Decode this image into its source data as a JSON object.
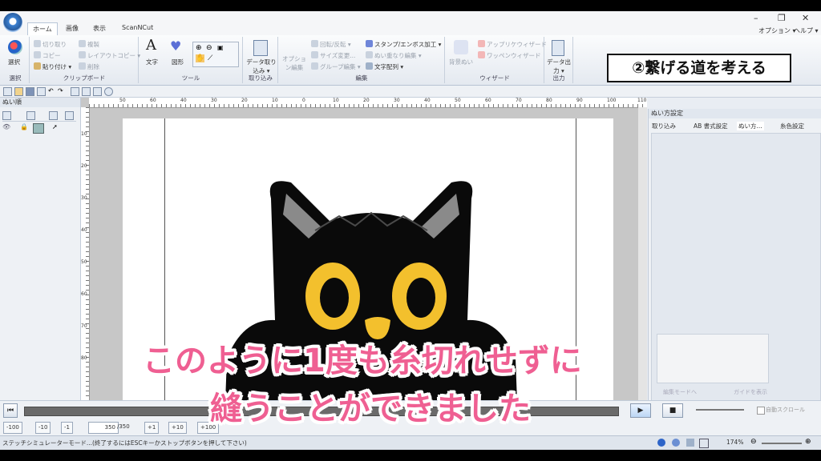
{
  "tabs": [
    "ホーム",
    "画像",
    "表示",
    "ScanNCut"
  ],
  "menu": {
    "options": "オプション ▾",
    "help": "ヘルプ ▾"
  },
  "ribbon": {
    "select": {
      "label": "選択",
      "group": "選択"
    },
    "clipboard": {
      "cut": "切り取り",
      "copy": "コピー",
      "paste": "貼り付け ▾",
      "duplicate": "複製",
      "layout_copy": "レイアウトコピー ▾",
      "delete": "削除",
      "group": "クリップボード"
    },
    "tools": {
      "text": "文字",
      "shape": "図形",
      "group": "ツール"
    },
    "import": {
      "label": "データ取り込み ▾",
      "group": "取り込み"
    },
    "edit": {
      "options": "オプション編集",
      "rotate": "回転/反転 ▾",
      "resize": "サイズ変更...",
      "group_edit": "グループ編集 ▾",
      "stamp": "スタンプ/エンボス加工 ▾",
      "overlap": "ぬい重なり編集 ▾",
      "text_arrange": "文字配列 ▾",
      "group": "編集"
    },
    "wizard": {
      "bg": "背景ぬい",
      "applique": "アップリケウィザード",
      "patch": "ワッペンウィザード",
      "group": "ウィザード"
    },
    "output": {
      "label": "データ出力 ▾",
      "group": "出力"
    }
  },
  "left_panel": {
    "title": "ぬい順"
  },
  "right_panel": {
    "title": "ぬい方設定",
    "tabs": [
      "取り込み",
      "AB 書式設定",
      "ぬい方...",
      "糸色設定"
    ],
    "btn1": "編集モードへ",
    "btn2": "ガイドを表示"
  },
  "ruler": {
    "top": [
      "50",
      "60",
      "40",
      "30",
      "20",
      "10",
      "0",
      "10",
      "20",
      "30",
      "40",
      "50",
      "60",
      "70",
      "80",
      "90",
      "100",
      "110"
    ],
    "left": [
      "10",
      "20",
      "30",
      "40",
      "50",
      "60",
      "70",
      "80"
    ]
  },
  "steps": {
    "b1": "-100",
    "b2": "-10",
    "b3": "-1",
    "value": "350",
    "total": "/350",
    "b4": "+1",
    "b5": "+10",
    "b6": "+100"
  },
  "auto_scroll": "自動スクロール",
  "status": {
    "message": "ステッチシミュレーターモード...(終了するにはESCキーかストップボタンを押して下さい)",
    "zoom": "174%"
  },
  "overlay": {
    "title_box": "②繋げる道を考える",
    "caption_line1": "このように1度も糸切れせずに",
    "caption_line2": "縫うことができました"
  },
  "colors": {
    "cat_body": "#0a0a0a",
    "cat_eye": "#f3c02d",
    "ear_inner": "#888888",
    "caption_pink": "#ef5f92"
  }
}
